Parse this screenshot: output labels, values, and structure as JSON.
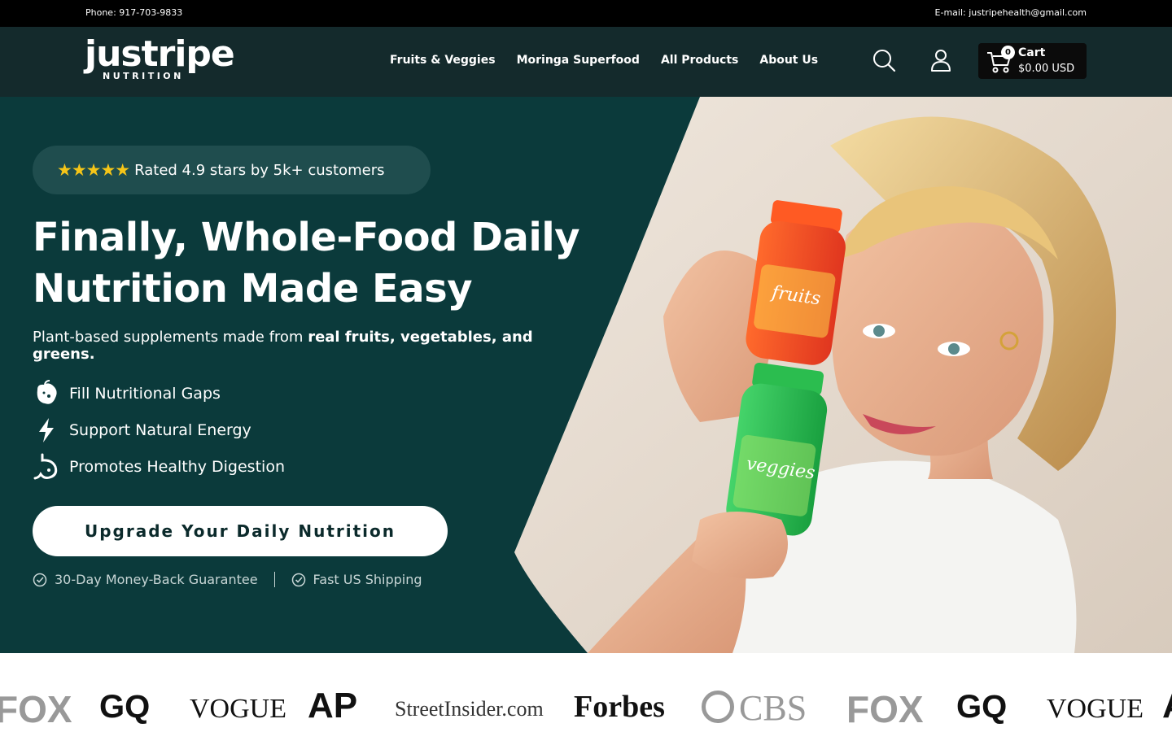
{
  "topbar": {
    "phone": "Phone: 917-703-9833",
    "email": "E-mail: justripehealth@gmail.com"
  },
  "header": {
    "logo": {
      "word": "justripe",
      "sub": "NUTRITION"
    },
    "nav": [
      {
        "label": "Fruits & Veggies"
      },
      {
        "label": "Moringa Superfood"
      },
      {
        "label": "All Products"
      },
      {
        "label": "About Us"
      }
    ],
    "icons": [
      "search-icon",
      "account-icon",
      "cart-icon"
    ],
    "cart": {
      "count": "0",
      "label": "Cart",
      "total": "$0.00 USD"
    }
  },
  "hero": {
    "rating": {
      "stars": "★★★★★",
      "text": "Rated 4.9 stars by 5k+ customers"
    },
    "headline_line1": "Finally, Whole-Food Daily",
    "headline_line2": "Nutrition Made Easy",
    "subline_plain": "Plant-based supplements made from ",
    "subline_bold": "real fruits, vegetables, and greens.",
    "benefits": [
      {
        "label": "Fill Nutritional Gaps",
        "icon": "fruit-icon"
      },
      {
        "label": "Support Natural Energy",
        "icon": "lightning-icon"
      },
      {
        "label": "Promotes Healthy Digestion",
        "icon": "stomach-icon"
      }
    ],
    "cta": "Upgrade Your Daily Nutrition",
    "guarantees": [
      {
        "label": "30-Day Money-Back Guarantee",
        "icon": "check-circle-icon"
      },
      {
        "label": "Fast US Shipping",
        "icon": "check-circle-icon"
      }
    ],
    "product_labels": {
      "bottle_top": "fruits",
      "bottle_bottom": "veggies"
    }
  },
  "press": {
    "logos": [
      "FOX",
      "GQ",
      "VOGUE",
      "AP",
      "StreetInsider.com",
      "Forbes",
      "CBS",
      "FOX",
      "GQ",
      "VOGUE",
      "AP"
    ]
  },
  "colors": {
    "topbar": "#000000",
    "header": "#142a2c",
    "hero_bg": "#0b3a3b",
    "rating_pill": "#1f4d4e",
    "star": "#f5c518",
    "cta_bg": "#ffffff",
    "cta_text": "#0b2a2b"
  }
}
